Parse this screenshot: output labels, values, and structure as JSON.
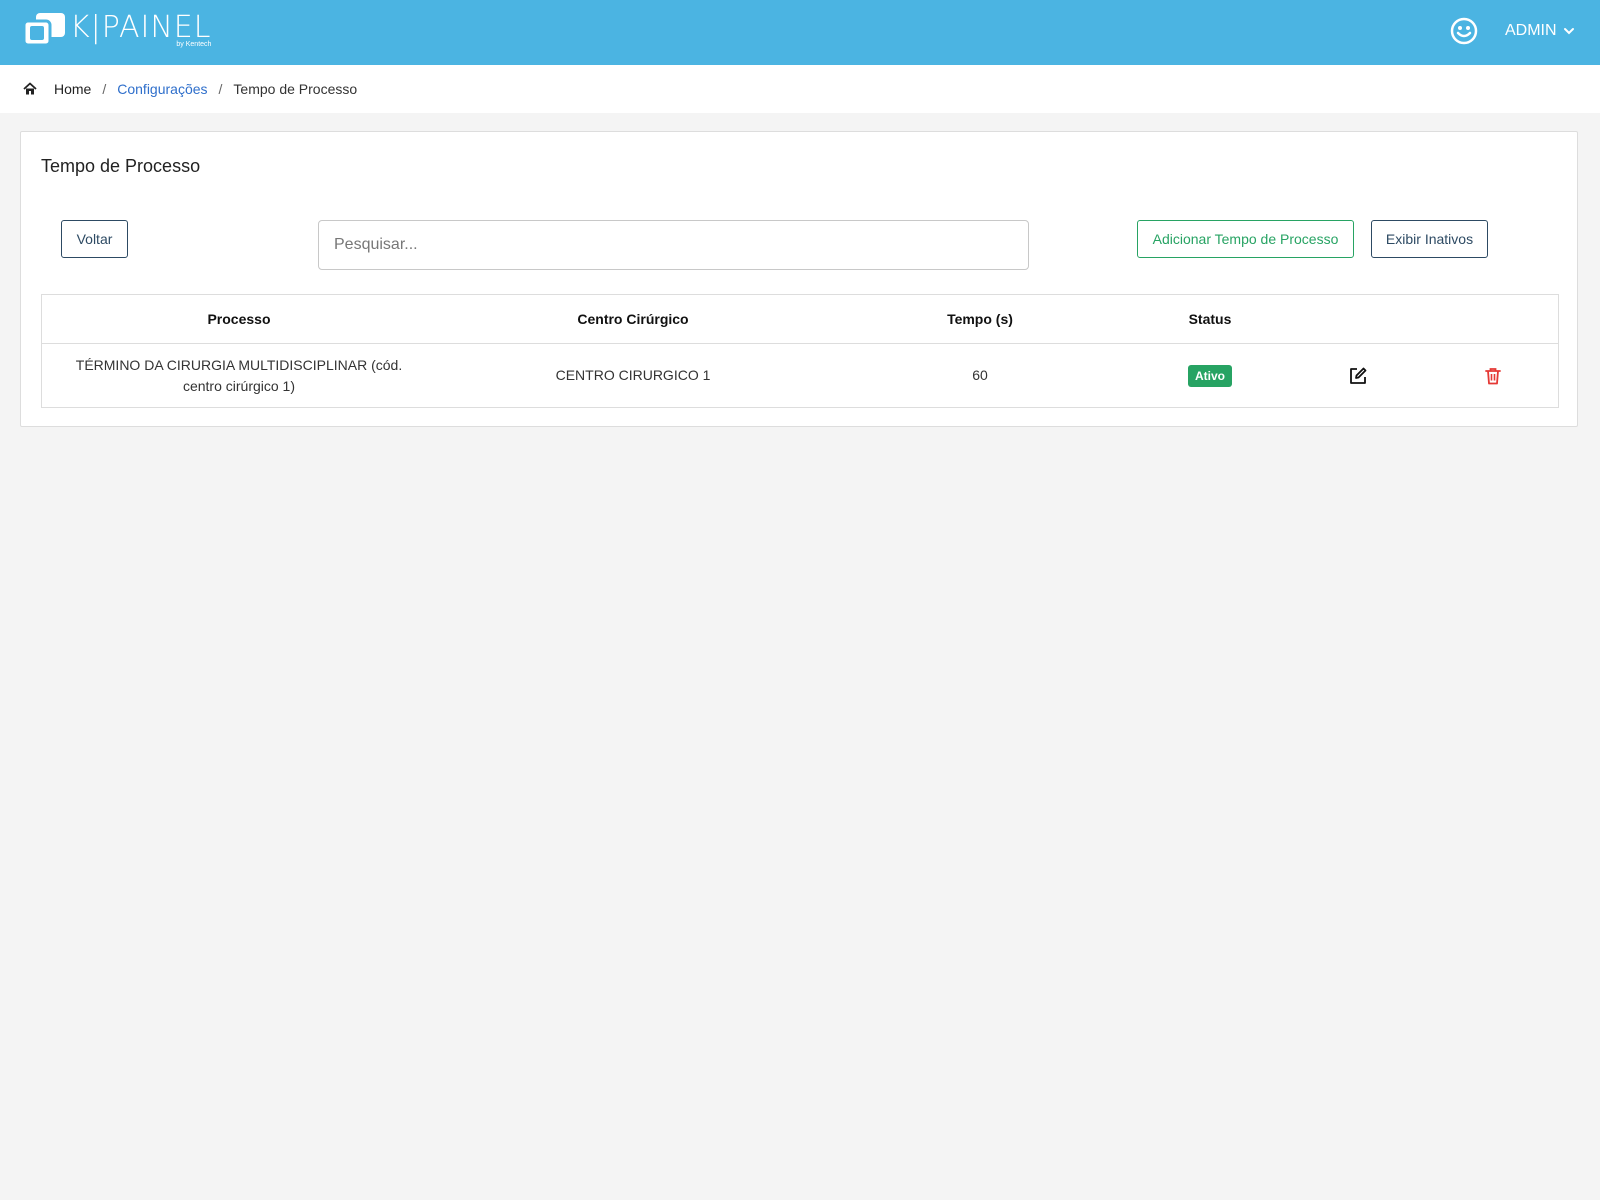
{
  "header": {
    "logo_text": "K|PAINEL",
    "logo_subtext": "by Kentech",
    "user_label": "ADMIN",
    "brand_color": "#4bb4e2"
  },
  "breadcrumb": {
    "home": "Home",
    "separator": "/",
    "section": "Configurações",
    "current": "Tempo de Processo"
  },
  "page": {
    "title": "Tempo de Processo",
    "back_label": "Voltar",
    "search_placeholder": "Pesquisar...",
    "add_label": "Adicionar Tempo de Processo",
    "show_inactive_label": "Exibir Inativos"
  },
  "table": {
    "columns": [
      "Processo",
      "Centro Cirúrgico",
      "Tempo (s)",
      "Status"
    ],
    "rows": [
      {
        "processo": "TÉRMINO DA CIRURGIA MULTIDISCIPLINAR (cód. centro cirúrgico 1)",
        "centro": "CENTRO CIRURGICO 1",
        "tempo": "60",
        "status": "Ativo",
        "status_color": "#27a363"
      }
    ]
  },
  "icons": {
    "home": "home-icon",
    "user": "smiley-icon",
    "dropdown": "chevron-down-icon",
    "edit": "edit-icon",
    "delete": "trash-icon"
  }
}
